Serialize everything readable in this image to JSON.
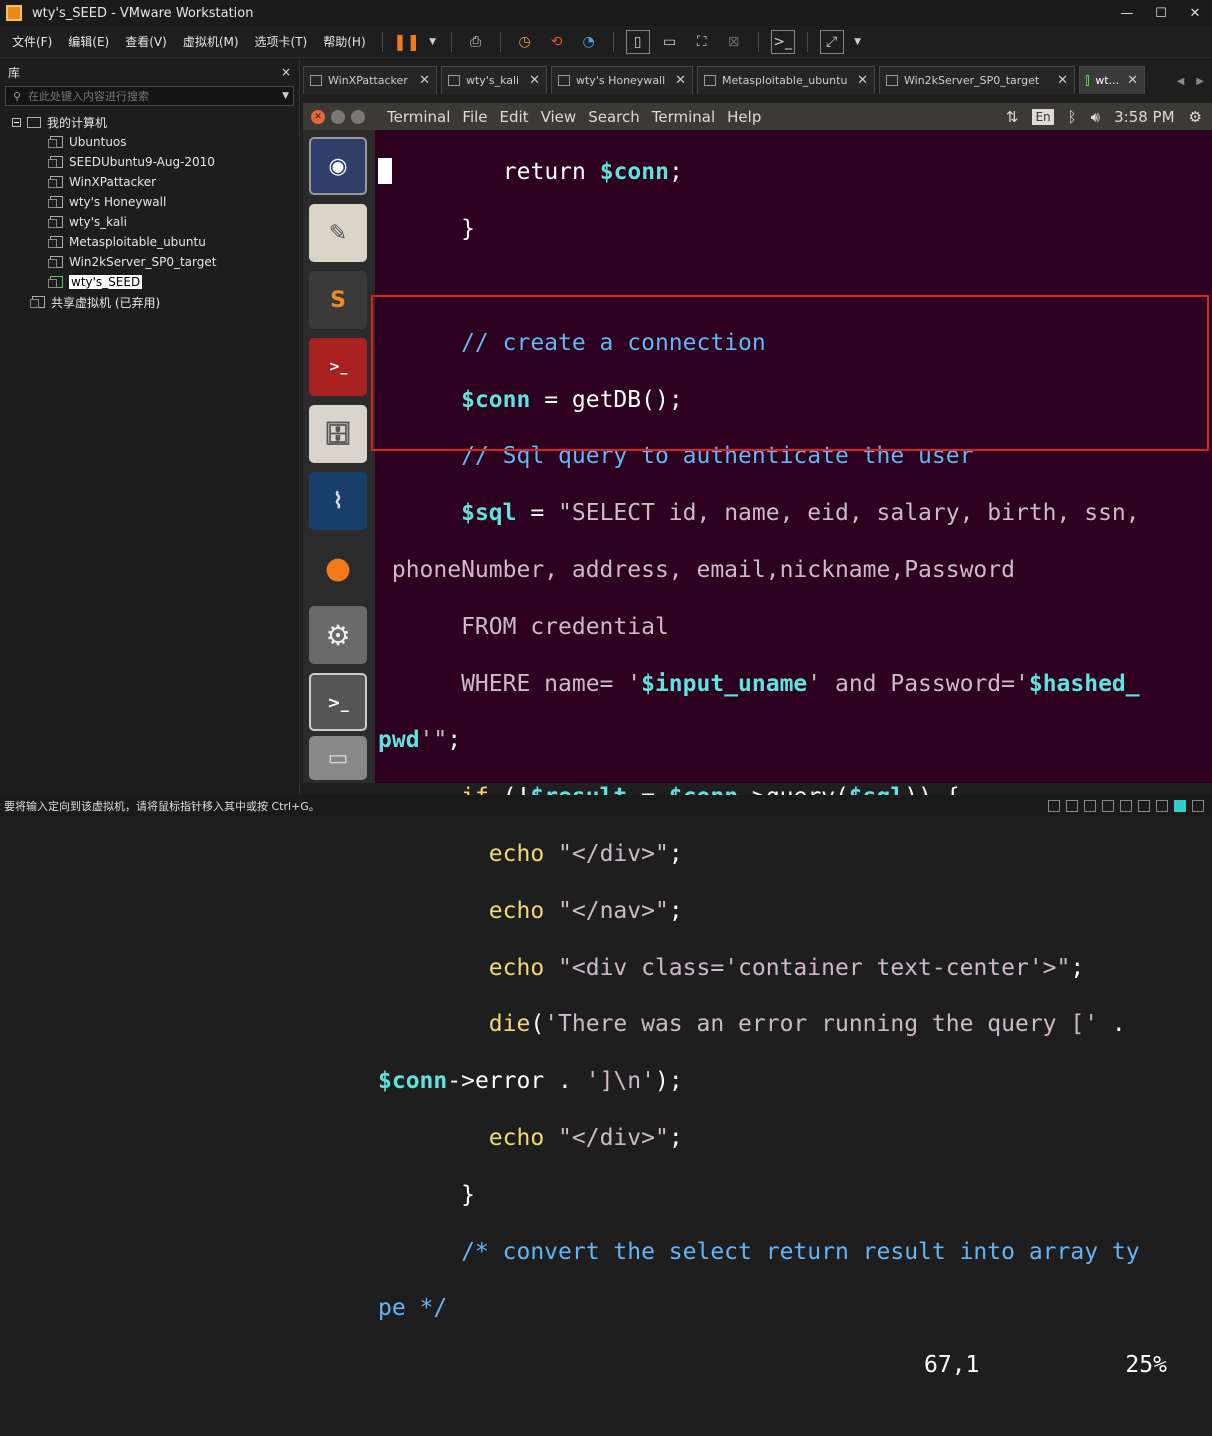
{
  "window": {
    "title": "wty's_SEED - VMware Workstation",
    "minimize": "—",
    "maximize": "☐",
    "close": "✕"
  },
  "menubar": {
    "items": [
      "文件(F)",
      "编辑(E)",
      "查看(V)",
      "虚拟机(M)",
      "选项卡(T)",
      "帮助(H)"
    ]
  },
  "library": {
    "title": "库",
    "close": "×",
    "search_placeholder": "在此处键入内容进行搜索",
    "root": "我的计算机",
    "items": [
      "Ubuntuos",
      "SEEDUbuntu9-Aug-2010",
      "WinXPattacker",
      "wty's Honeywall",
      "wty's_kali",
      "Metasploitable_ubuntu",
      "Win2kServer_SP0_target",
      "wty's_SEED"
    ],
    "shared": "共享虚拟机 (已弃用)"
  },
  "tabs": [
    {
      "label": "WinXPattacker"
    },
    {
      "label": "wty's_kali"
    },
    {
      "label": "wty's Honeywall"
    },
    {
      "label": "Metasploitable_ubuntu"
    },
    {
      "label": "Win2kServer_SP0_target"
    },
    {
      "label": "wt..."
    }
  ],
  "ubuntu": {
    "menus": [
      "Terminal",
      "File",
      "Edit",
      "View",
      "Search",
      "Terminal",
      "Help"
    ],
    "lang": "En",
    "time": "3:58 PM"
  },
  "terminal": {
    "l1a": "        return ",
    "l1b": "$conn",
    ";": ";",
    "l2": "      }",
    "l4": "      // create a connection",
    "l5a": "      ",
    "l5b": "$conn",
    " l5c": " = getDB();",
    "l6": "      // Sql query to authenticate the user",
    "l7b": "$sql",
    "l7c": " = ",
    "l7d": "\"SELECT id, name, eid, salary, birth, ssn,",
    "l8": " phoneNumber, address, email,nickname,Password",
    "l9": "      FROM credential",
    "l10a": "      WHERE name= '",
    "l10b": "$input_uname",
    "l10c": "' and Password='",
    "l10d": "$hashed_",
    "l11a": "pwd",
    "l11b": "'\"",
    "l12a": "      ",
    "l12b": "if",
    " l12c": " (!",
    "l12d": "$result",
    " l12e": " = ",
    "l12f": "$conn",
    "l12g": "->query(",
    "l12h": "$sql",
    "l12i": ")) {",
    "echo": "echo",
    "s1": "\"</div>\"",
    "s2": "\"</nav>\"",
    "s3": "\"<div class='container text-center'>\"",
    "die": "die",
    "diestr": "'There was an error running the query ['",
    " dot": " .",
    "err_b": "->",
    "err_c": "error . ",
    "err_d": "']\\n'",
    "err_e": ");",
    "s4": "\"</div>\"",
    "close": "      }",
    "c1": "      /* convert the select return result into array ty",
    "c2": "pe */",
    "pos": "67,1",
    "pct": "25%"
  },
  "statusbar": {
    "text": "要将输入定向到该虚拟机，请将鼠标指针移入其中或按 Ctrl+G。"
  },
  "colors": {
    "keyword": "#f2d870",
    "variable": "#5fe3df",
    "comment": "#64b5f6",
    "string": "#cdb9c8",
    "terminal_bg": "#2c001e",
    "highlight": "#e02020"
  }
}
